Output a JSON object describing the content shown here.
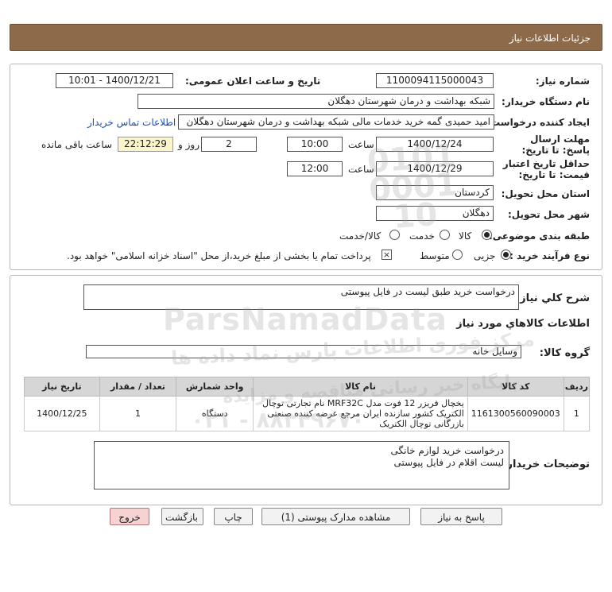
{
  "header": {
    "title": "جزئیات اطلاعات نیاز"
  },
  "form": {
    "need_number_label": "شماره نیاز:",
    "need_number": "1100094115000043",
    "announce_label": "تاریخ و ساعت اعلان عمومی:",
    "announce_value": "1400/12/21 - 10:01",
    "buyer_org_label": "نام دستگاه خریدار:",
    "buyer_org": "شبکه بهداشت و درمان شهرستان دهگلان",
    "creator_label": "ایجاد کننده درخواست:",
    "creator": "امید حمیدی گمه خرید خدمات مالی شبکه بهداشت و درمان شهرستان دهگلان",
    "contact_link": "اطلاعات تماس خریدار",
    "reply_deadline_label": "مهلت ارسال پاسخ: تا تاریخ:",
    "reply_date": "1400/12/24",
    "time_word": "ساعت",
    "reply_time": "10:00",
    "days_value": "2",
    "days_word": "روز و",
    "remaining_time": "22:12:29",
    "remaining_label": "ساعت باقی مانده",
    "validity_label": "حداقل تاریخ اعتبار قیمت: تا تاریخ:",
    "validity_date": "1400/12/29",
    "validity_time": "12:00",
    "province_label": "استان محل تحویل:",
    "province": "کردستان",
    "city_label": "شهر محل تحویل:",
    "city": "دهگلان",
    "category_label": "طبقه بندی موضوعی:",
    "category_options": [
      "کالا",
      "خدمت",
      "کالا/خدمت"
    ],
    "category_selected": "کالا",
    "process_label": "نوع فرآیند خرید :",
    "process_options": [
      "جزیی",
      "متوسط"
    ],
    "process_selected": "جزیی",
    "payment_note": "پرداخت تمام یا بخشی از مبلغ خرید،از محل \"اسناد خزانه اسلامی\" خواهد بود."
  },
  "summary": {
    "label": "شرح کلي نياز:",
    "value": "درخواست خرید طبق لیست در فایل پیوستی",
    "goods_info_title": "اطلاعات کالاهاي مورد نياز",
    "group_label": "گروه کالا:",
    "group_value": "وسایل خانه"
  },
  "table": {
    "headers": [
      "ردیف",
      "کد کالا",
      "نام کالا",
      "واحد شمارش",
      "تعداد / مقدار",
      "تاریخ نیاز"
    ],
    "rows": [
      {
        "index": "1",
        "code": "1161300560090003",
        "name": "یخچال فریزر 12 فوت مدل MRF32C نام تجارتی توچال الکتریک کشور سازنده ایران مرجع عرضه کننده صنعتی بازرگانی توچال الکتریک",
        "unit": "دستگاه",
        "qty": "1",
        "date": "1400/12/25"
      }
    ]
  },
  "notes": {
    "label": "توضیحات خریدار:",
    "line1": "درخواست خرید لوازم خانگی",
    "line2": "لیست اقلام در فایل پیوستی"
  },
  "buttons": {
    "reply": "پاسخ به نیاز",
    "view_docs": "مشاهده مدارک پیوستی (1)",
    "print": "چاپ",
    "back": "بازگشت",
    "exit": "خروج"
  },
  "watermark": {
    "brand": "ParsNamadData",
    "line_fa1": "مرکز فوری اطلاعات پارس نماد داده ها",
    "line_fa2": "پایگاه خبر رسانی مناقصه و مزایده",
    "phone": "۰۲۱ - ۸۸۳۴۹۶۷۰",
    "stamp": "0101 0001 10"
  },
  "colors": {
    "header_bg": "#8d6b4a",
    "link": "#1a4fb5",
    "remaining_bg": "#fbf5c9",
    "exit_bg": "#f6d2d2"
  }
}
